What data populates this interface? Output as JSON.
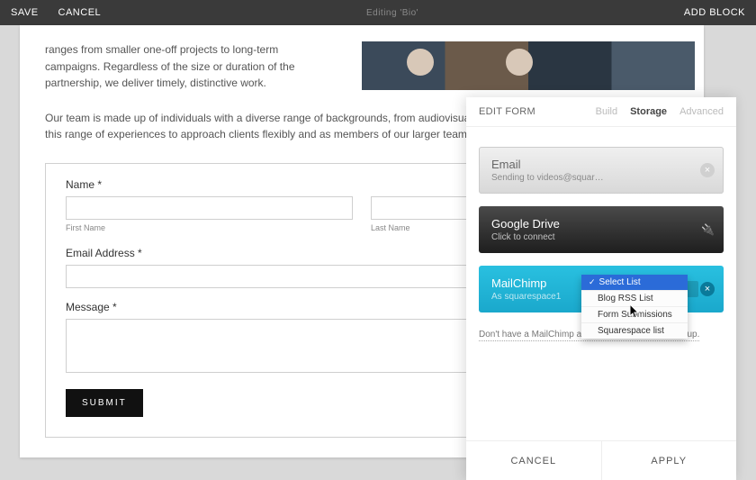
{
  "topbar": {
    "save": "SAVE",
    "cancel": "CANCEL",
    "center": "Editing 'Bio'",
    "add_block": "ADD BLOCK"
  },
  "page": {
    "para1": "ranges from smaller one-off projects to long-term campaigns. Regardless of the size or duration of the partnership, we deliver timely, distinctive work.",
    "para2": "Our team is made up of individuals with a diverse range of backgrounds, from audiovisual production to graphic design. We leverage this range of experiences to approach clients flexibly and as members of our larger team."
  },
  "form": {
    "name_label": "Name *",
    "first_name_sub": "First Name",
    "last_name_sub": "Last Name",
    "email_label": "Email Address *",
    "message_label": "Message *",
    "submit": "SUBMIT"
  },
  "panel": {
    "title": "EDIT FORM",
    "tabs": {
      "build": "Build",
      "storage": "Storage",
      "advanced": "Advanced"
    },
    "email_card": {
      "title": "Email",
      "sub": "Sending to videos@squar…"
    },
    "drive_card": {
      "title": "Google Drive",
      "sub": "Click to connect"
    },
    "mc_card": {
      "title": "MailChimp",
      "sub": "As squarespace1"
    },
    "signup": "Don't have a MailChimp account? Click here to sign up.",
    "cancel": "CANCEL",
    "apply": "APPLY"
  },
  "dropdown": {
    "selected": "Select List",
    "options": [
      "Blog RSS List",
      "Form Submissions",
      "Squarespace list"
    ]
  }
}
